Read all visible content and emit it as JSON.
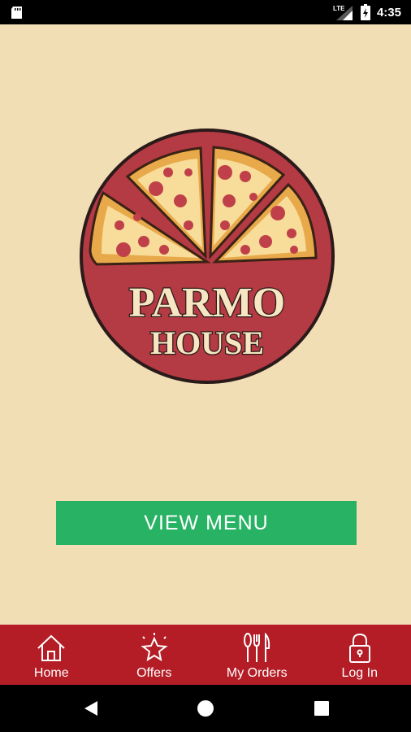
{
  "status_bar": {
    "network": "LTE",
    "time": "4:35",
    "icons": [
      "sd-card-icon",
      "lte-signal-icon",
      "battery-charging-icon"
    ]
  },
  "logo": {
    "line1": "PARMO",
    "line2": "HOUSE",
    "colors": {
      "ring": "#b43a44",
      "text": "#f6e7c2",
      "crust": "#e8a94a",
      "cheese": "#f7dc9a",
      "pepperoni": "#c0404a"
    }
  },
  "main": {
    "view_menu_label": "VIEW MENU",
    "button_color": "#28b264",
    "background_color": "#f1deb4"
  },
  "bottom_nav": {
    "background_color": "#b41d26",
    "items": [
      {
        "label": "Home",
        "icon": "home-icon"
      },
      {
        "label": "Offers",
        "icon": "star-icon"
      },
      {
        "label": "My Orders",
        "icon": "cutlery-icon"
      },
      {
        "label": "Log In",
        "icon": "lock-icon"
      }
    ]
  },
  "system_nav": {
    "icons": [
      "back-icon",
      "home-circle-icon",
      "recents-icon"
    ]
  }
}
